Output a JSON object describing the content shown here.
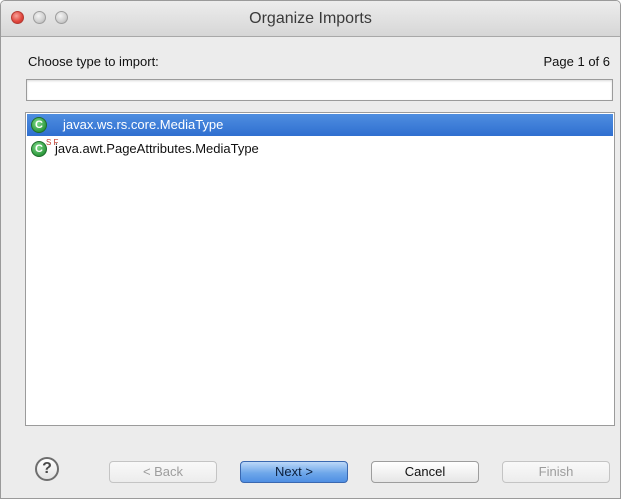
{
  "window": {
    "title": "Organize Imports"
  },
  "dialog": {
    "choose_label": "Choose type to import:",
    "page_indicator": "Page 1 of 6",
    "filter": {
      "value": "",
      "placeholder": ""
    }
  },
  "list": {
    "items": [
      {
        "text": "javax.ws.rs.core.MediaType",
        "icon": "class-icon",
        "modifiers": "",
        "selected": true
      },
      {
        "text": "java.awt.PageAttributes.MediaType",
        "icon": "class-icon",
        "modifiers": "S F",
        "selected": false
      }
    ]
  },
  "buttons": {
    "help": "?",
    "back": "< Back",
    "next": "Next >",
    "cancel": "Cancel",
    "finish": "Finish"
  },
  "colors": {
    "selection": "#3b7bd8",
    "default_button": "#5e9be6",
    "class_icon": "#2f9a3e"
  }
}
